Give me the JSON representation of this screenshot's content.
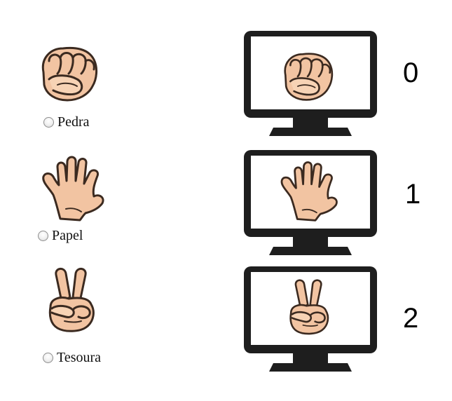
{
  "choices": [
    {
      "id": "rock",
      "label": "Pedra",
      "icon": "rock-hand-icon",
      "score": "0"
    },
    {
      "id": "paper",
      "label": "Papel",
      "icon": "paper-hand-icon",
      "score": "1"
    },
    {
      "id": "scissors",
      "label": "Tesoura",
      "icon": "scissors-hand-icon",
      "score": "2"
    }
  ],
  "colors": {
    "skin": "#f2c4a2",
    "skin_shadow": "#e0a680",
    "outline": "#3b2a20",
    "monitor": "#1e1e1e",
    "screen": "#ffffff"
  }
}
